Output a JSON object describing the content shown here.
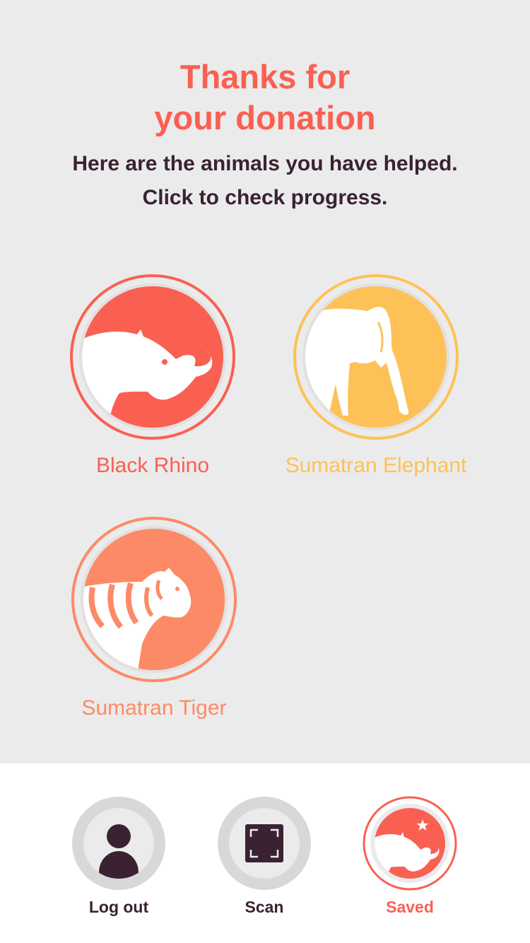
{
  "header": {
    "title_line1": "Thanks for",
    "title_line2": "your donation",
    "subtitle_line1": "Here are the animals you have helped.",
    "subtitle_line2": "Click to check progress."
  },
  "animals": [
    {
      "name": "Black Rhino",
      "color": "#fa6052",
      "icon": "rhino-icon"
    },
    {
      "name": "Sumatran Elephant",
      "color": "#fec157",
      "icon": "elephant-icon"
    },
    {
      "name": "Sumatran Tiger",
      "color": "#fd8a66",
      "icon": "tiger-icon"
    }
  ],
  "nav": {
    "logout_label": "Log out",
    "scan_label": "Scan",
    "saved_label": "Saved",
    "active": "Saved",
    "accent": "#fa6052",
    "dark": "#3a2233"
  }
}
